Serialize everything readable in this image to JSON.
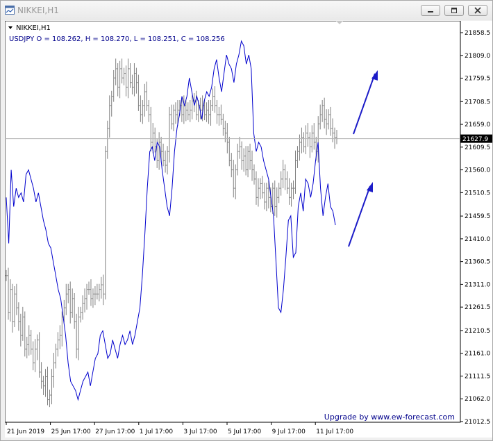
{
  "window": {
    "title": "NIKKEI,H1",
    "icon": "chart-window-icon",
    "buttons": [
      "minimize-icon",
      "restore-icon",
      "close-icon"
    ]
  },
  "chart_header": {
    "symbol": "NIKKEI,H1",
    "overlay": "USDJPY O = 108.262, H = 108.270, L = 108.251, C = 108.256"
  },
  "watermark": "Upgrade by www.ew-forecast.com",
  "colors": {
    "nikkei_bars": "#808080",
    "usdjpy_line": "#0000cd",
    "arrows": "#1c1cc8",
    "price_line": "#b4b4b4",
    "text_blue": "#00008b"
  },
  "chart_data": {
    "type": "bar",
    "title": "NIKKEI,H1",
    "subtitle": "USDJPY O = 108.262, H = 108.270, L = 108.251, C = 108.256",
    "x_ticks": [
      "21 Jun 2019",
      "25 Jun 17:00",
      "27 Jun 17:00",
      "1 Jul 17:00",
      "3 Jul 17:00",
      "5 Jul 17:00",
      "9 Jul 17:00",
      "11 Jul 17:00"
    ],
    "y_ticks": [
      21858.5,
      21809.0,
      21759.5,
      21708.5,
      21659.0,
      21609.5,
      21560.0,
      21510.5,
      21459.5,
      21410.0,
      21360.5,
      21311.0,
      21261.5,
      21210.5,
      21161.0,
      21111.5,
      21062.0,
      21012.5
    ],
    "ylim": [
      21000,
      21870
    ],
    "current_price": 21627.9,
    "grid": false,
    "series": [
      {
        "name": "NIKKEI,H1",
        "style": "ohlc-bars",
        "close": [
          21330,
          21250,
          21300,
          21230,
          21290,
          21260,
          21230,
          21200,
          21240,
          21170,
          21180,
          21200,
          21170,
          21140,
          21170,
          21190,
          21120,
          21100,
          21090,
          21110,
          21060,
          21070,
          21110,
          21140,
          21170,
          21190,
          21200,
          21240,
          21260,
          21290,
          21300,
          21250,
          21280,
          21230,
          21170,
          21240,
          21250,
          21270,
          21280,
          21300,
          21300,
          21280,
          21290,
          21290,
          21290,
          21300,
          21310,
          21290,
          21600,
          21650,
          21700,
          21720,
          21760,
          21780,
          21740,
          21780,
          21760,
          21770,
          21740,
          21780,
          21750,
          21740,
          21770,
          21750,
          21700,
          21680,
          21700,
          21730,
          21700,
          21680,
          21620,
          21640,
          21610,
          21580,
          21620,
          21600,
          21580,
          21570,
          21600,
          21680,
          21660,
          21690,
          21680,
          21690,
          21700,
          21680,
          21700,
          21690,
          21680,
          21690,
          21710,
          21710,
          21680,
          21700,
          21690,
          21700,
          21680,
          21690,
          21680,
          21700,
          21720,
          21700,
          21680,
          21680,
          21670,
          21650,
          21640,
          21620,
          21580,
          21560,
          21520,
          21560,
          21600,
          21610,
          21580,
          21590,
          21560,
          21600,
          21580,
          21560,
          21540,
          21500,
          21520,
          21530,
          21510,
          21490,
          21520,
          21500,
          21480,
          21520,
          21480,
          21500,
          21520,
          21540,
          21560,
          21540,
          21520,
          21500,
          21520,
          21520,
          21580,
          21600,
          21620,
          21630,
          21610,
          21640,
          21630,
          21610,
          21640,
          21620,
          21600,
          21660,
          21680,
          21700,
          21670,
          21660,
          21680,
          21650,
          21640,
          21630,
          21628
        ]
      },
      {
        "name": "USDJPY",
        "style": "line",
        "close": [
          21500,
          21400,
          21560,
          21480,
          21520,
          21500,
          21510,
          21490,
          21550,
          21560,
          21540,
          21520,
          21490,
          21510,
          21480,
          21450,
          21430,
          21400,
          21390,
          21360,
          21330,
          21300,
          21280,
          21240,
          21200,
          21140,
          21100,
          21090,
          21080,
          21060,
          21080,
          21100,
          21110,
          21120,
          21090,
          21120,
          21150,
          21160,
          21200,
          21210,
          21180,
          21150,
          21160,
          21190,
          21170,
          21150,
          21180,
          21200,
          21180,
          21190,
          21210,
          21180,
          21200,
          21230,
          21260,
          21330,
          21420,
          21520,
          21600,
          21610,
          21580,
          21620,
          21610,
          21560,
          21520,
          21480,
          21460,
          21520,
          21600,
          21650,
          21680,
          21720,
          21700,
          21720,
          21760,
          21730,
          21700,
          21720,
          21700,
          21670,
          21710,
          21730,
          21720,
          21740,
          21780,
          21800,
          21760,
          21730,
          21770,
          21810,
          21790,
          21780,
          21750,
          21790,
          21810,
          21840,
          21830,
          21790,
          21810,
          21780,
          21640,
          21600,
          21620,
          21610,
          21580,
          21560,
          21540,
          21500,
          21460,
          21360,
          21260,
          21250,
          21300,
          21370,
          21450,
          21460,
          21370,
          21380,
          21480,
          21510,
          21470,
          21540,
          21530,
          21500,
          21530,
          21580,
          21620,
          21520,
          21460,
          21500,
          21530,
          21480,
          21470,
          21440
        ]
      }
    ]
  }
}
